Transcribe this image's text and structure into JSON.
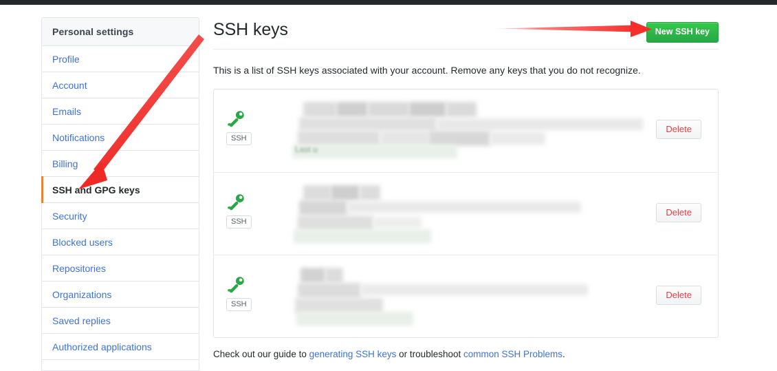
{
  "window": {
    "top_bar_color": "#24292e"
  },
  "sidebar": {
    "header": "Personal settings",
    "items": [
      {
        "label": "Profile",
        "selected": false
      },
      {
        "label": "Account",
        "selected": false
      },
      {
        "label": "Emails",
        "selected": false
      },
      {
        "label": "Notifications",
        "selected": false
      },
      {
        "label": "Billing",
        "selected": false
      },
      {
        "label": "SSH and GPG keys",
        "selected": true
      },
      {
        "label": "Security",
        "selected": false
      },
      {
        "label": "Blocked users",
        "selected": false
      },
      {
        "label": "Repositories",
        "selected": false
      },
      {
        "label": "Organizations",
        "selected": false
      },
      {
        "label": "Saved replies",
        "selected": false
      },
      {
        "label": "Authorized applications",
        "selected": false
      }
    ],
    "selected_accent": "#e8813a",
    "link_color": "#3d73d6"
  },
  "main": {
    "title": "SSH keys",
    "new_key_button": "New SSH key",
    "new_key_button_color": "#28a745",
    "description": "This is a list of SSH keys associated with your account. Remove any keys that you do not recognize.",
    "keys": [
      {
        "icon": "key-icon",
        "badge": "SSH",
        "title_redacted": true,
        "fingerprint_redacted": true,
        "meta_text": "Last u",
        "delete_label": "Delete"
      },
      {
        "icon": "key-icon",
        "badge": "SSH",
        "title_redacted": true,
        "fingerprint_redacted": true,
        "meta_text": "",
        "delete_label": "Delete"
      },
      {
        "icon": "key-icon",
        "badge": "SSH",
        "title_redacted": true,
        "fingerprint_redacted": true,
        "meta_text": "",
        "delete_label": "Delete"
      }
    ],
    "footer": {
      "prefix": "Check out our guide to ",
      "link1": "generating SSH keys",
      "middle": " or troubleshoot ",
      "link2": "common SSH Problems",
      "suffix": "."
    }
  },
  "annotations": {
    "color": "#f5302c",
    "arrow_to_button_label": "arrow pointing to New SSH key button",
    "arrow_to_sidebar_label": "arrow pointing to SSH and GPG keys sidebar item"
  }
}
